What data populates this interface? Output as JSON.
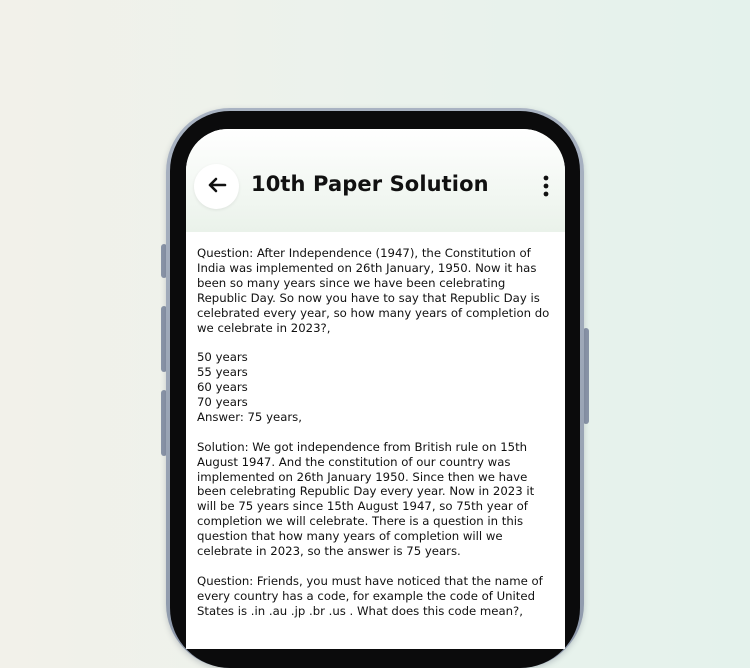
{
  "colors": {
    "background_left": "#f2f1ea",
    "background_right": "#e4f2ec",
    "phone_frame": "#a9b3c2",
    "phone_bezel": "#0b0b0c",
    "header_tint": "#eaf2ea",
    "text": "#111111"
  },
  "header": {
    "back_icon": "arrow-left-icon",
    "title": "10th Paper Solution",
    "menu_icon": "more-vertical-icon"
  },
  "content": {
    "question1": {
      "text": "Question: After Independence (1947), the Constitution of India was implemented on 26th January, 1950. Now it has been so many years since we have been celebrating Republic Day. So now you have to say that Republic Day is celebrated every year, so how many years of completion do we celebrate in 2023?,",
      "options": [
        "50 years",
        "55 years",
        "60 years",
        "70 years"
      ],
      "answer": "Answer: 75 years,"
    },
    "solution1": "Solution: We got independence from British rule on 15th August 1947. And the constitution of our country was implemented on 26th January 1950. Since then we have been celebrating Republic Day every year. Now in 2023 it will be 75 years since 15th August 1947, so 75th year of completion we will celebrate. There is a question in this question that how many years of completion will we celebrate in 2023, so the answer is 75 years.",
    "question2": {
      "text": "Question: Friends, you must have noticed that the name of every country has a code, for example the code of United States is .in .au .jp .br .us . What does this code mean?,"
    }
  }
}
